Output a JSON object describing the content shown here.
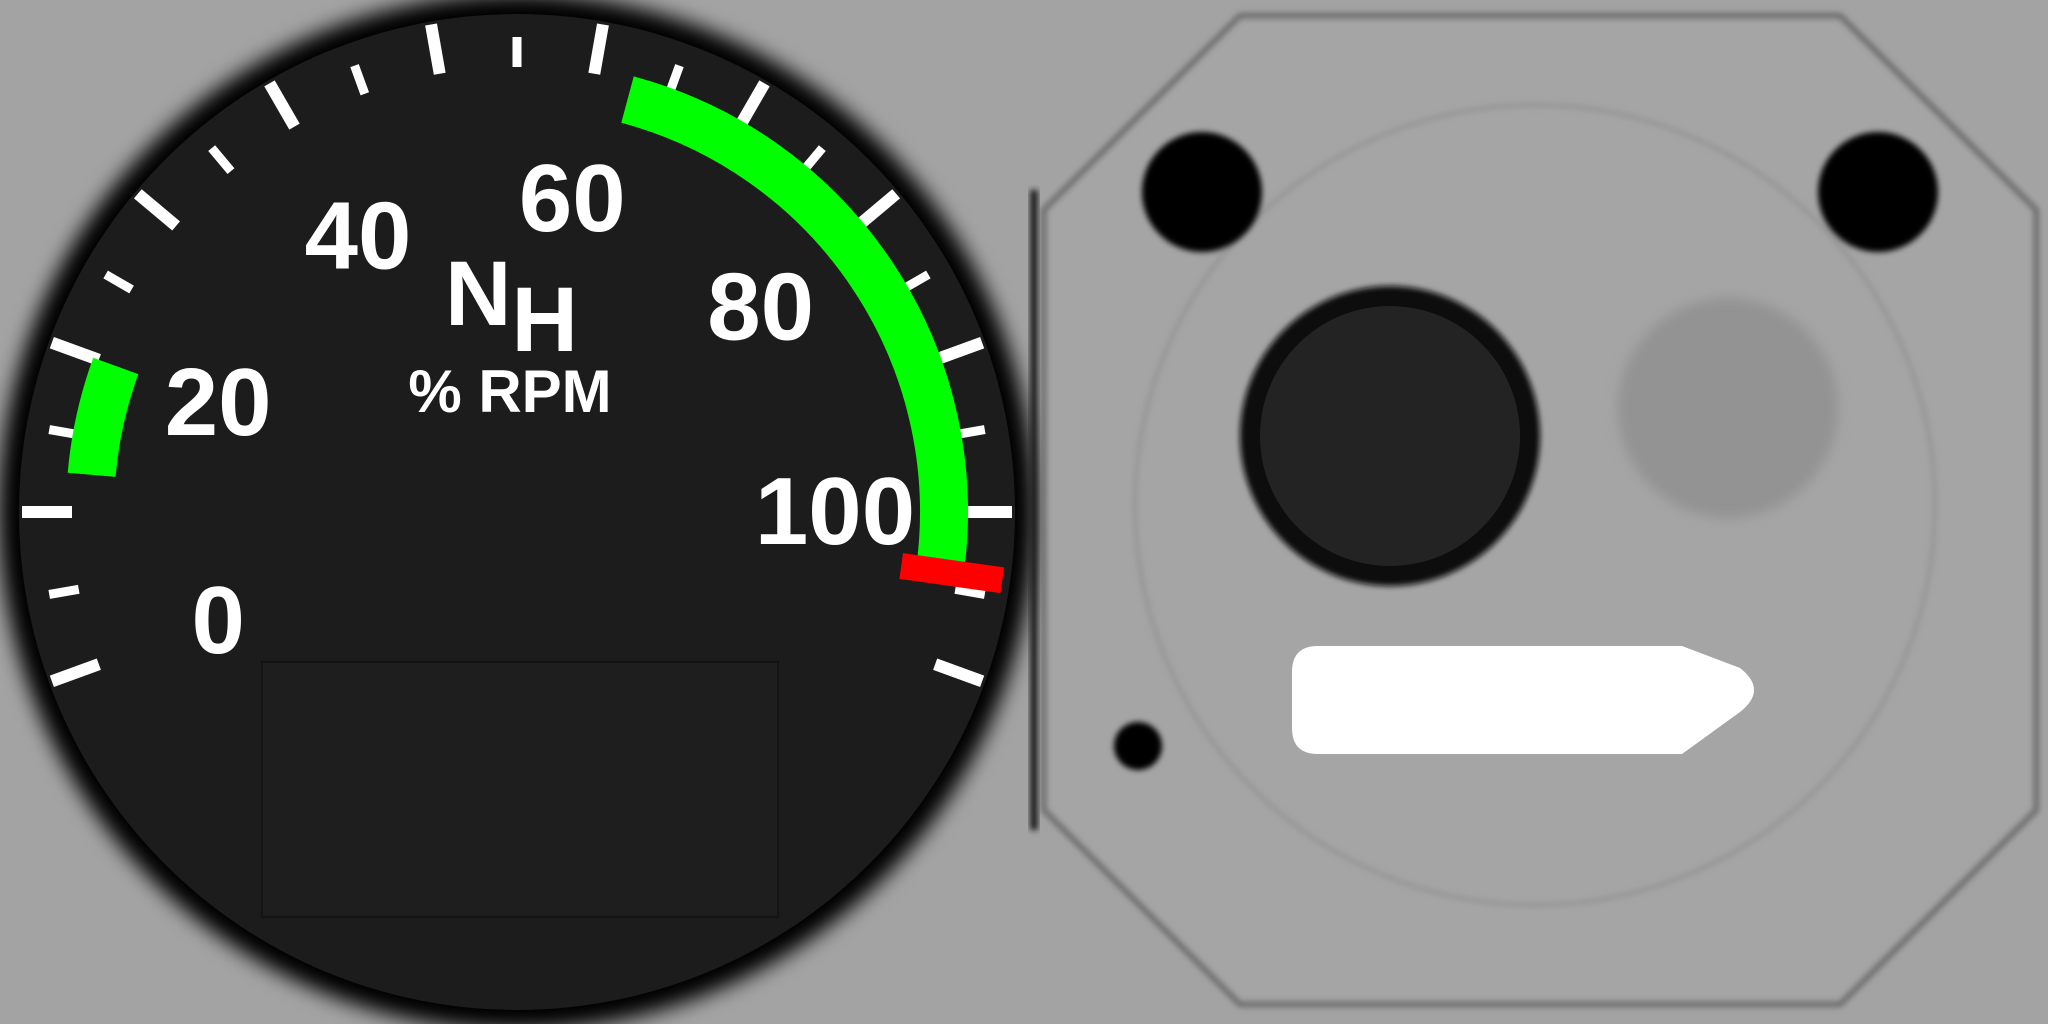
{
  "gauge": {
    "title_main": "N",
    "title_sub": "H",
    "units": "% RPM",
    "scale": {
      "min": 0,
      "max": 110,
      "major_step": 10,
      "minor_step": 5
    },
    "major_labels": [
      "0",
      "20",
      "40",
      "60",
      "80",
      "100"
    ],
    "ranges": [
      {
        "name": "green-low",
        "from": 12.5,
        "to": 20,
        "color": "#00ff00"
      },
      {
        "name": "green-high",
        "from": 62.5,
        "to": 104,
        "color": "#00ff00"
      }
    ],
    "redline": {
      "value": 104,
      "color": "#ff0000"
    }
  },
  "colors": {
    "background": "#a3a3a3",
    "dial": "#1c1c1c",
    "plate": "#a3a3a3"
  }
}
